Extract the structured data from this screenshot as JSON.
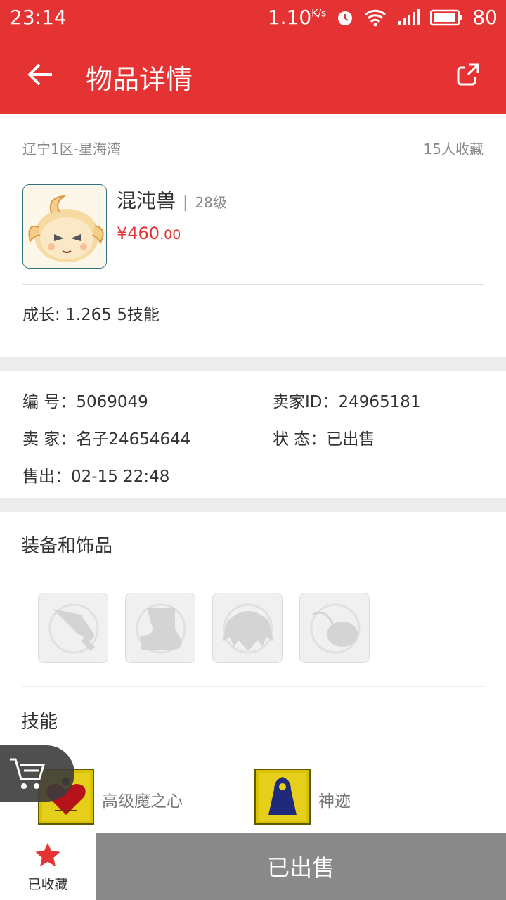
{
  "status_bar": {
    "time": "23:14",
    "speed": "1.10",
    "speed_unit": "K/s",
    "battery": "80"
  },
  "header": {
    "title": "物品详情"
  },
  "item": {
    "server": "辽宁1区-星海湾",
    "favorites": "15人收藏",
    "name": "混沌兽",
    "level": "28级",
    "price_main": "¥460",
    "price_decimal": ".00",
    "growth": "成长: 1.265  5技能"
  },
  "details": {
    "number_label": "编  号：",
    "number_value": "5069049",
    "seller_id_label": "卖家ID：",
    "seller_id_value": "24965181",
    "seller_label": "卖  家：",
    "seller_value": "名子24654644",
    "status_label": "状  态：",
    "status_value": "已出售",
    "sold_label": "售出：",
    "sold_value": "02-15 22:48"
  },
  "equipment": {
    "title": "装备和饰品",
    "slots": [
      "weapon-icon",
      "boots-icon",
      "armor-icon",
      "accessory-icon"
    ]
  },
  "skills": {
    "title": "技能",
    "items": [
      {
        "name": "高级魔之心"
      },
      {
        "name": "神迹"
      }
    ]
  },
  "bottom": {
    "favorite_label": "已收藏",
    "action_label": "已出售"
  },
  "colors": {
    "accent": "#e53333",
    "sold_gray": "#8a8a8a"
  }
}
